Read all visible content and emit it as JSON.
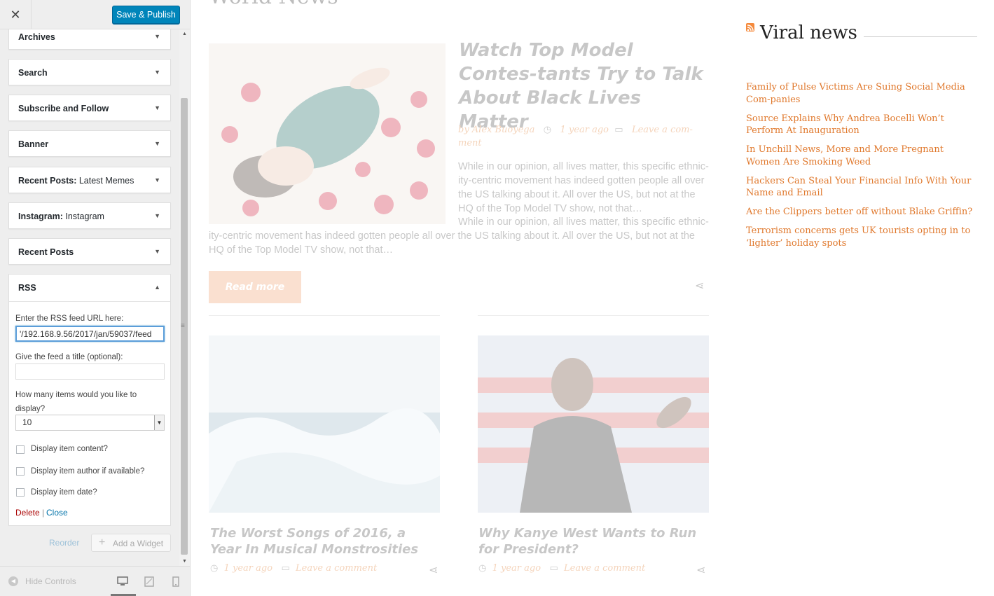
{
  "customizer": {
    "close_label": "✕",
    "save_label": "Save & Publish",
    "widgets": [
      {
        "title": "Archives",
        "sub": ""
      },
      {
        "title": "Search",
        "sub": ""
      },
      {
        "title": "Subscribe and Follow",
        "sub": ""
      },
      {
        "title": "Banner",
        "sub": ""
      },
      {
        "title": "Recent Posts:",
        "sub": " Latest Memes"
      },
      {
        "title": "Instagram:",
        "sub": " Instagram"
      },
      {
        "title": "Recent Posts",
        "sub": ""
      }
    ],
    "rss": {
      "title": "RSS",
      "url_label": "Enter the RSS feed URL here:",
      "url_value": "'/192.168.9.56/2017/jan/59037/feed",
      "title_label": "Give the feed a title (optional):",
      "title_value": "",
      "count_label": "How many items would you like to display?",
      "count_value": "10",
      "checkboxes": [
        {
          "label": "Display item content?",
          "checked": false
        },
        {
          "label": "Display item author if available?",
          "checked": false
        },
        {
          "label": "Display item date?",
          "checked": false
        }
      ],
      "delete_label": "Delete",
      "separator": "|",
      "close_label": "Close"
    },
    "reorder_label": "Reorder",
    "add_widget_label": "Add a Widget",
    "hide_controls_label": "Hide Controls",
    "accent_color": "#0085ba"
  },
  "preview": {
    "section_title": "World News",
    "hero": {
      "title": "Watch Top Model Contes-tants Try to Talk About Black Lives Matter",
      "author": "by Alex Buoyega",
      "time": "1 year ago",
      "comment": "Leave a com-ment",
      "excerpt_1": "While in our opinion, all lives matter, this specific ethnic-ity-centric movement has indeed gotten people all over the US talking about it. All over the US, but not at the HQ of the Top Model TV show, not that…",
      "excerpt_2": "While in our opinion, all lives matter, this specific ethnic-ity-centric movement has indeed gotten people all over the US talking about it. All over the US, but not at the HQ of the Top Model TV show, not that…",
      "read_more": "Read more"
    },
    "cards": [
      {
        "title": "The Worst Songs of 2016, a Year In Musical Monstrosities",
        "time": "1 year ago",
        "comment": "Leave a comment"
      },
      {
        "title": "Why Kanye West Wants to Run for President?",
        "time": "1 year ago",
        "comment": "Leave a comment"
      }
    ],
    "viral": {
      "title": "Viral news",
      "items": [
        "Family of Pulse Victims Are Suing Social Media Com-panies",
        "Source Explains Why Andrea Bocelli Won’t Perform At Inauguration",
        "In Unchill News, More and More Pregnant Women Are Smoking Weed",
        "Hackers Can Steal Your Financial Info With Your Name and Email",
        "Are the Clippers better off without Blake Griffin?",
        "Terrorism concerns gets UK tourists opting in to ‘lighter’ holiday spots"
      ],
      "link_color": "#e0782c"
    }
  }
}
